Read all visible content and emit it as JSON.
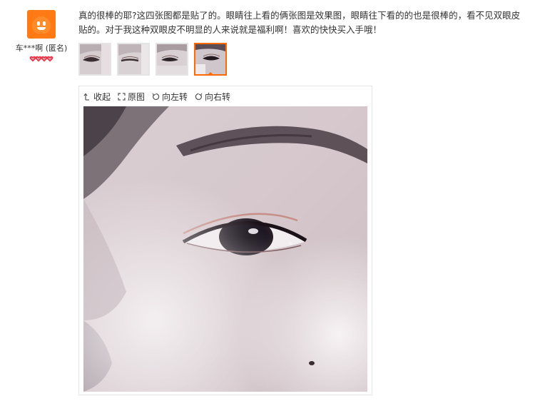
{
  "user": {
    "name": "车***啊 (匿名)",
    "avatar_icon": "cartoon-avatar-icon",
    "level_icon": "heart-level-icon",
    "level_count": 4
  },
  "review": {
    "text": "真的很棒的耶?这四张图都是贴了的。眼睛往上看的俩张图是效果图，眼睛往下看的的也是很棒的，看不见双眼皮贴的。对于我这种双眼皮不明显的人来说就是福利啊！喜欢的快快买入手哦！"
  },
  "thumbnails": {
    "count": 4,
    "active_index": 3
  },
  "viewer": {
    "collapse_label": "收起",
    "original_label": "原图",
    "rotate_left_label": "向左转",
    "rotate_right_label": "向右转"
  },
  "colors": {
    "accent": "#ff6a00",
    "avatar": "#ff7a14",
    "heart": "#e8374a",
    "border": "#e5e5e5"
  }
}
